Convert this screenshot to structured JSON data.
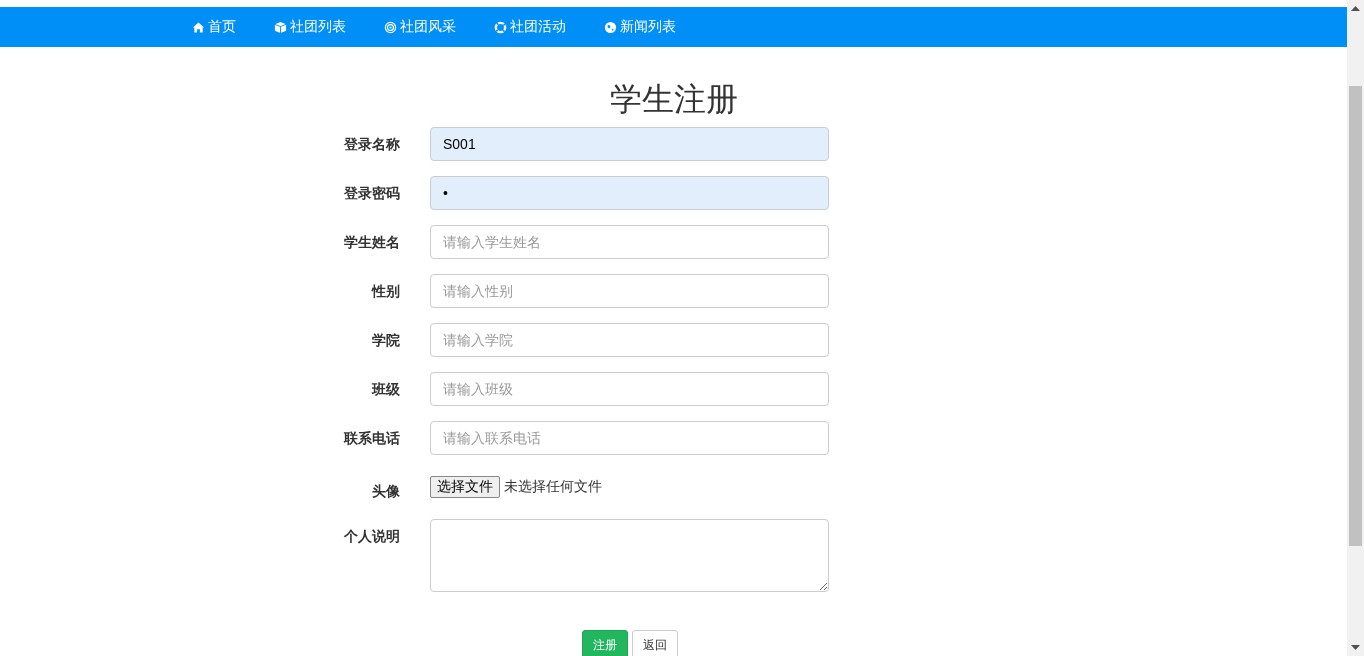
{
  "nav": [
    {
      "kind": "home",
      "label": "首页"
    },
    {
      "kind": "cube",
      "label": "社团列表"
    },
    {
      "kind": "target",
      "label": "社团风采"
    },
    {
      "kind": "lifebuoy",
      "label": "社团活动"
    },
    {
      "kind": "globe",
      "label": "新闻列表"
    }
  ],
  "title": "学生注册",
  "fields": [
    {
      "kind": "text",
      "label": "登录名称",
      "value": "S001",
      "autofilled": true
    },
    {
      "kind": "text",
      "label": "登录密码",
      "value": "•",
      "autofilled": true
    },
    {
      "kind": "text",
      "label": "学生姓名",
      "placeholder": "请输入学生姓名",
      "autofilled": false
    },
    {
      "kind": "text",
      "label": "性别",
      "placeholder": "请输入性别",
      "autofilled": false
    },
    {
      "kind": "text",
      "label": "学院",
      "placeholder": "请输入学院",
      "autofilled": false
    },
    {
      "kind": "text",
      "label": "班级",
      "placeholder": "请输入班级",
      "autofilled": false
    },
    {
      "kind": "text",
      "label": "联系电话",
      "placeholder": "请输入联系电话",
      "autofilled": false
    },
    {
      "kind": "file",
      "label": "头像",
      "button": "选择文件",
      "status": "未选择任何文件"
    },
    {
      "kind": "textarea",
      "label": "个人说明"
    }
  ],
  "buttons": [
    {
      "kind": "primary",
      "label": "注册"
    },
    {
      "kind": "default",
      "label": "返回"
    }
  ]
}
